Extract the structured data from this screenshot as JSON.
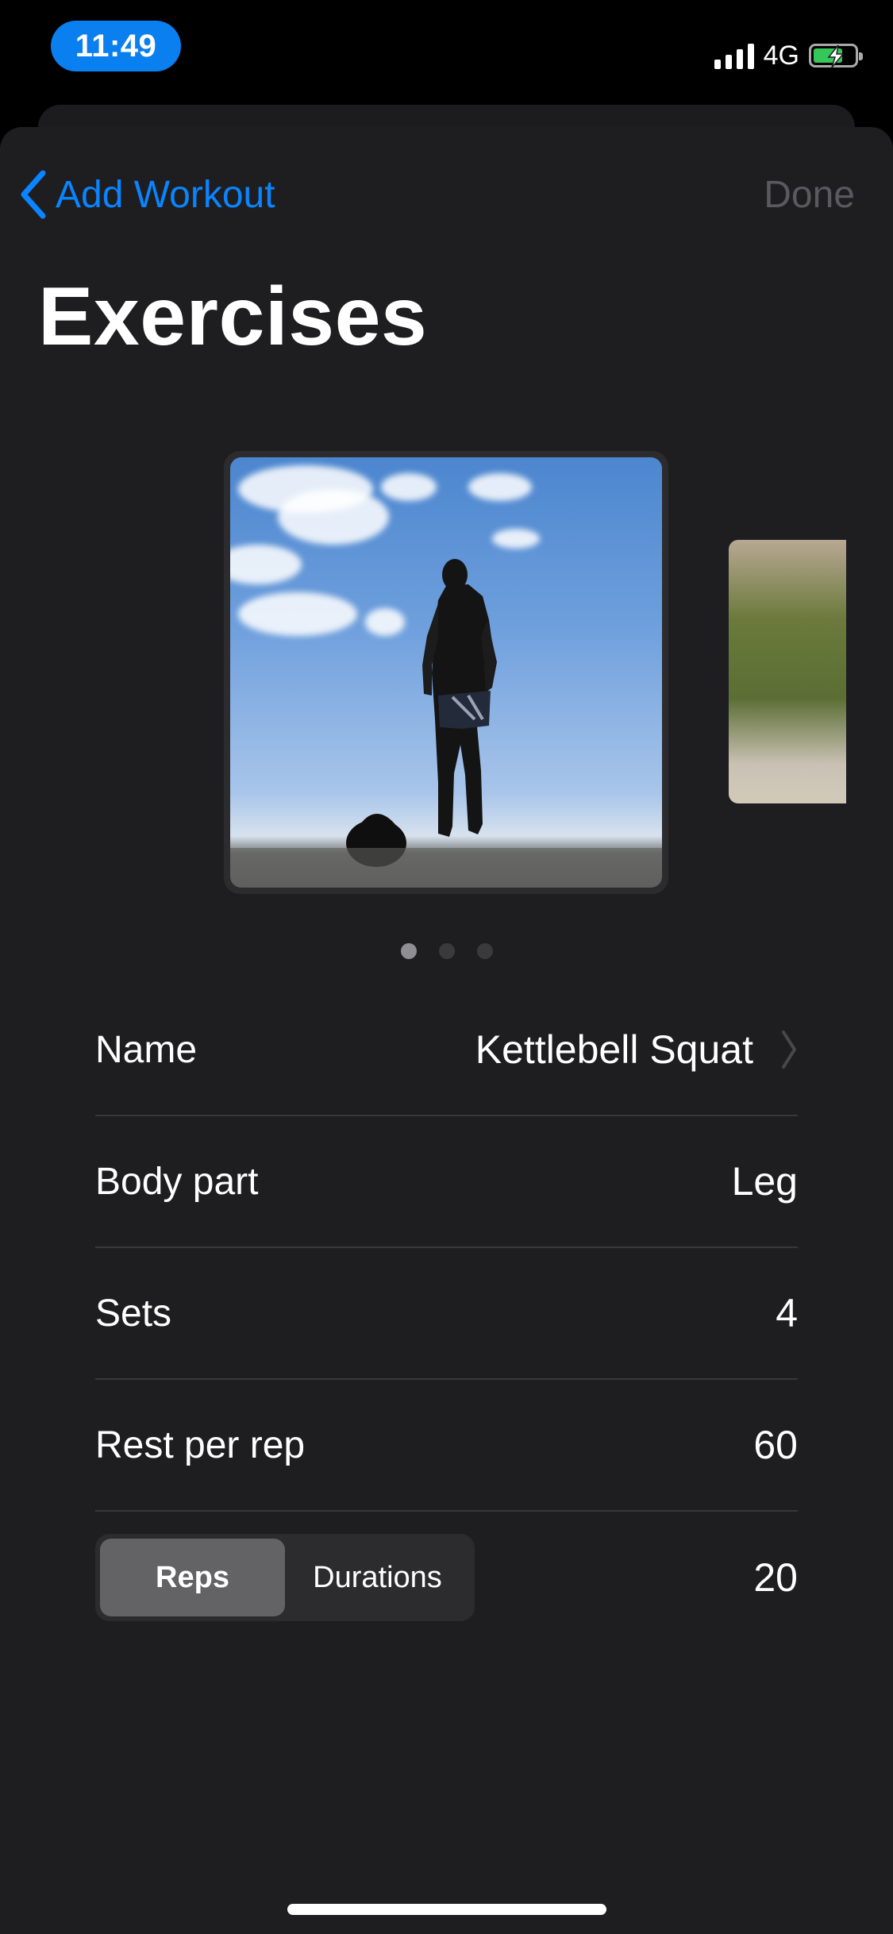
{
  "status_bar": {
    "time": "11:49",
    "network": "4G",
    "icons": [
      "signal-icon",
      "battery-charging-icon"
    ]
  },
  "nav": {
    "back_label": "Add Workout",
    "done_label": "Done"
  },
  "page": {
    "title": "Exercises"
  },
  "carousel": {
    "page_count": 3,
    "current_page": 1
  },
  "form": {
    "name": {
      "label": "Name",
      "value": "Kettlebell Squat"
    },
    "body_part": {
      "label": "Body part",
      "value": "Leg"
    },
    "sets": {
      "label": "Sets",
      "value": "4"
    },
    "rest": {
      "label": "Rest per rep",
      "value": "60"
    },
    "mode": {
      "options": [
        "Reps",
        "Durations"
      ],
      "selected": "Reps",
      "value": "20"
    }
  },
  "colors": {
    "accent": "#0a84ff",
    "background": "#1e1e20",
    "separator": "#38383a"
  }
}
